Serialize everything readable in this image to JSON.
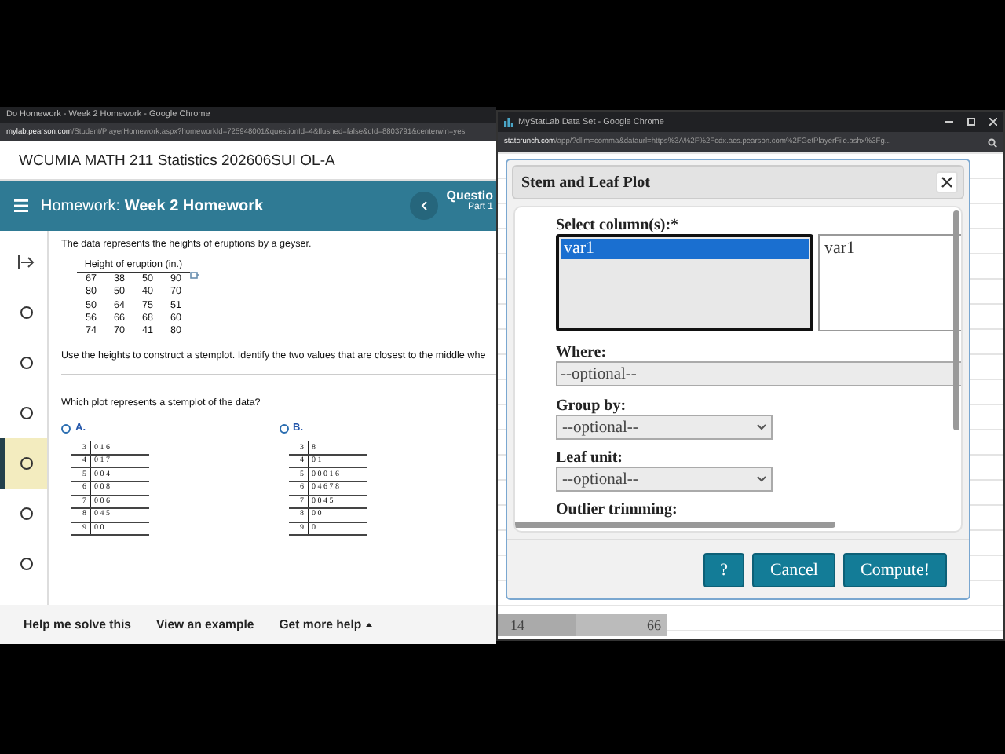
{
  "homework_window": {
    "title": "Do Homework - Week 2 Homework - Google Chrome",
    "url_host": "mylab.pearson.com",
    "url_path": "/Student/PlayerHomework.aspx?homeworkId=725948001&questionId=4&flushed=false&cId=8803791&centerwin=yes"
  },
  "course_title": "WCUMIA MATH 211 Statistics 202606SUI OL-A",
  "header": {
    "label": "Homework:",
    "name": "Week 2 Homework",
    "question": "Questio",
    "part": "Part 1"
  },
  "question_nav": [
    {
      "selected": false
    },
    {
      "selected": false
    },
    {
      "selected": false
    },
    {
      "selected": true
    },
    {
      "selected": false
    },
    {
      "selected": false
    }
  ],
  "question": {
    "intro": "The data represents the heights of eruptions by a geyser.",
    "table": {
      "caption": "Height of eruption (in.)",
      "rows": [
        [
          "67",
          "38",
          "50",
          "90"
        ],
        [
          "80",
          "50",
          "40",
          "70"
        ],
        [
          "50",
          "64",
          "75",
          "51"
        ],
        [
          "56",
          "66",
          "68",
          "60"
        ],
        [
          "74",
          "70",
          "41",
          "80"
        ]
      ]
    },
    "instruction": "Use the heights to construct a stemplot. Identify the two values that are closest to the middle whe",
    "prompt": "Which plot represents a stemplot of the data?",
    "options": [
      {
        "letter": "A.",
        "selected": false,
        "rows": [
          {
            "stem": "3",
            "leaves": "0 1 6"
          },
          {
            "stem": "4",
            "leaves": "0 1 7"
          },
          {
            "stem": "5",
            "leaves": "0 0 4"
          },
          {
            "stem": "6",
            "leaves": "0 0 8"
          },
          {
            "stem": "7",
            "leaves": "0 0 6"
          },
          {
            "stem": "8",
            "leaves": "0 4 5"
          },
          {
            "stem": "9",
            "leaves": "0 0"
          }
        ]
      },
      {
        "letter": "B.",
        "selected": false,
        "rows": [
          {
            "stem": "3",
            "leaves": "8"
          },
          {
            "stem": "4",
            "leaves": "0 1"
          },
          {
            "stem": "5",
            "leaves": "0 0 0 1 6"
          },
          {
            "stem": "6",
            "leaves": "0 4 6 7 8"
          },
          {
            "stem": "7",
            "leaves": "0 0 4 5"
          },
          {
            "stem": "8",
            "leaves": "0 0"
          },
          {
            "stem": "9",
            "leaves": "0"
          }
        ]
      }
    ]
  },
  "help_bar": [
    "Help me solve this",
    "View an example",
    "Get more help"
  ],
  "statcrunch_window": {
    "title": "MyStatLab Data Set - Google Chrome",
    "url_host": "statcrunch.com",
    "url_path": "/app/?dlim=comma&dataurl=https%3A%2F%2Fcdx.acs.pearson.com%2FGetPlayerFile.ashx%3Fg..."
  },
  "sheet_row": [
    "14",
    "66"
  ],
  "dialog": {
    "title": "Stem and Leaf Plot",
    "select_label": "Select column(s):*",
    "columns": [
      {
        "name": "var1",
        "selected": true
      }
    ],
    "chosen": [
      "var1"
    ],
    "where": {
      "label": "Where:",
      "placeholder": "--optional--"
    },
    "group_by": {
      "label": "Group by:",
      "value": "--optional--"
    },
    "leaf_unit": {
      "label": "Leaf unit:",
      "value": "--optional--"
    },
    "outlier_label": "Outlier trimming:",
    "buttons": [
      "?",
      "Cancel",
      "Compute!"
    ]
  }
}
